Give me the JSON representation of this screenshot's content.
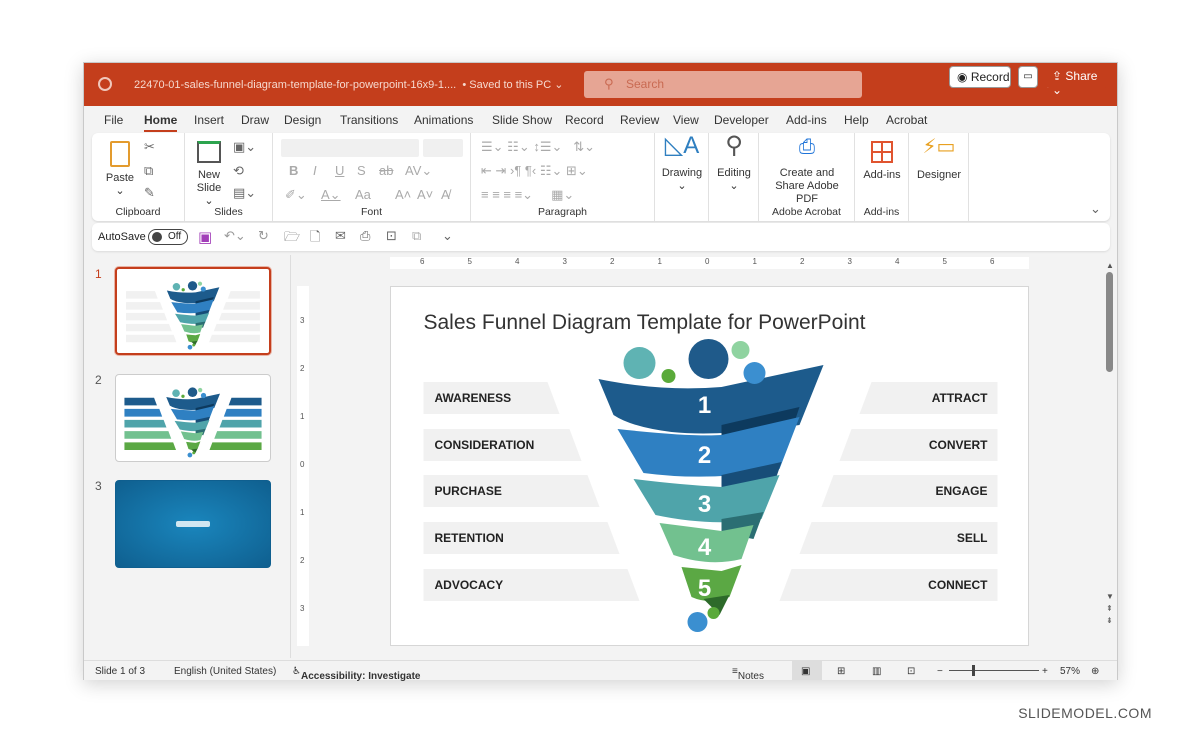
{
  "window": {
    "doc_title": "22470-01-sales-funnel-diagram-template-for-powerpoint-16x9-1....",
    "save_status": "• Saved to this PC ⌄",
    "search_placeholder": "Search",
    "accent": "#C43E1C"
  },
  "tabs": [
    "File",
    "Home",
    "Insert",
    "Draw",
    "Design",
    "Transitions",
    "Animations",
    "Slide Show",
    "Record",
    "Review",
    "View",
    "Developer",
    "Add-ins",
    "Help",
    "Acrobat"
  ],
  "active_tab": "Home",
  "header_buttons": {
    "record": "Record",
    "share": "Share"
  },
  "ribbon": {
    "clipboard": {
      "label": "Clipboard",
      "paste": "Paste"
    },
    "slides": {
      "label": "Slides",
      "new_slide": "New Slide"
    },
    "font": {
      "label": "Font",
      "bold": "B",
      "italic": "I",
      "underline": "U",
      "strike": "S",
      "grow": "A˄",
      "shrink": "A˅",
      "case": "Aa"
    },
    "paragraph": {
      "label": "Paragraph"
    },
    "drawing": "Drawing",
    "editing": "Editing",
    "acrobat": {
      "button": "Create and Share Adobe PDF",
      "label": "Adobe Acrobat"
    },
    "addins": {
      "button": "Add-ins",
      "label": "Add-ins"
    },
    "designer": "Designer"
  },
  "qat": {
    "autosave": "AutoSave",
    "autosave_state": "Off"
  },
  "thumbnails": [
    {
      "num": "1",
      "selected": true
    },
    {
      "num": "2",
      "selected": false
    },
    {
      "num": "3",
      "selected": false
    }
  ],
  "ruler": {
    "labels": [
      "6",
      "5",
      "4",
      "3",
      "2",
      "1",
      "0",
      "1",
      "2",
      "3",
      "4",
      "5",
      "6"
    ],
    "vlabels": [
      "3",
      "2",
      "1",
      "0",
      "1",
      "2",
      "3"
    ]
  },
  "slide": {
    "title": "Sales Funnel Diagram Template for PowerPoint",
    "left_labels": [
      "AWARENESS",
      "CONSIDERATION",
      "PURCHASE",
      "RETENTION",
      "ADVOCACY"
    ],
    "right_labels": [
      "ATTRACT",
      "CONVERT",
      "ENGAGE",
      "SELL",
      "CONNECT"
    ],
    "stages": [
      "1",
      "2",
      "3",
      "4",
      "5"
    ],
    "stage_colors": [
      "#1D5B8C",
      "#2F80C2",
      "#4FA4AA",
      "#72C18F",
      "#5BA844"
    ]
  },
  "status": {
    "slide": "Slide 1 of 3",
    "language": "English (United States)",
    "accessibility": "Accessibility: Investigate",
    "notes": "Notes",
    "zoom": "57%"
  },
  "watermark": "SLIDEMODEL.COM"
}
